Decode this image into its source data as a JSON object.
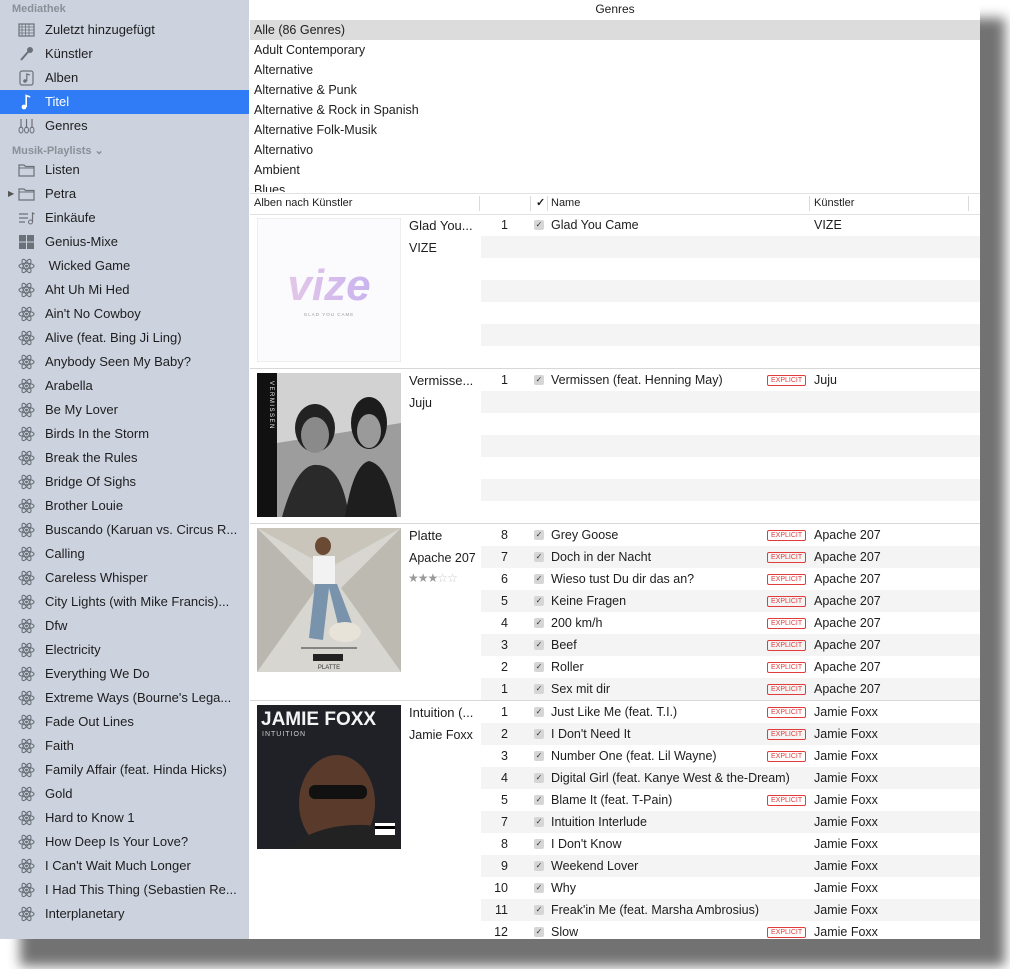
{
  "sidebar": {
    "library_header": "Mediathek",
    "library_items": [
      {
        "label": "Zuletzt hinzugefügt",
        "icon": "calendar-grid-icon"
      },
      {
        "label": "Künstler",
        "icon": "microphone-icon"
      },
      {
        "label": "Alben",
        "icon": "album-icon"
      },
      {
        "label": "Titel",
        "icon": "music-note-icon",
        "selected": true
      },
      {
        "label": "Genres",
        "icon": "guitars-icon"
      }
    ],
    "playlists_header": "Musik-Playlists ⌄",
    "playlist_items": [
      {
        "label": "Listen",
        "icon": "folder-icon"
      },
      {
        "label": "Petra",
        "icon": "folder-icon",
        "disclosure": "▶"
      },
      {
        "label": "Einkäufe",
        "icon": "purchased-list-icon"
      },
      {
        "label": "Genius-Mixe",
        "icon": "genius-grid-icon"
      },
      {
        "label": " Wicked Game",
        "icon": "genius-atom-icon"
      },
      {
        "label": "Aht Uh Mi Hed",
        "icon": "genius-atom-icon"
      },
      {
        "label": "Ain't No Cowboy",
        "icon": "genius-atom-icon"
      },
      {
        "label": "Alive (feat. Bing Ji Ling)",
        "icon": "genius-atom-icon"
      },
      {
        "label": "Anybody Seen My Baby?",
        "icon": "genius-atom-icon"
      },
      {
        "label": "Arabella",
        "icon": "genius-atom-icon"
      },
      {
        "label": "Be My Lover",
        "icon": "genius-atom-icon"
      },
      {
        "label": "Birds In the Storm",
        "icon": "genius-atom-icon"
      },
      {
        "label": "Break the Rules",
        "icon": "genius-atom-icon"
      },
      {
        "label": "Bridge Of Sighs",
        "icon": "genius-atom-icon"
      },
      {
        "label": "Brother Louie",
        "icon": "genius-atom-icon"
      },
      {
        "label": "Buscando (Karuan vs. Circus R...",
        "icon": "genius-atom-icon"
      },
      {
        "label": "Calling",
        "icon": "genius-atom-icon"
      },
      {
        "label": "Careless Whisper",
        "icon": "genius-atom-icon"
      },
      {
        "label": "City Lights (with Mike Francis)...",
        "icon": "genius-atom-icon"
      },
      {
        "label": "Dfw",
        "icon": "genius-atom-icon"
      },
      {
        "label": "Electricity",
        "icon": "genius-atom-icon"
      },
      {
        "label": "Everything We Do",
        "icon": "genius-atom-icon"
      },
      {
        "label": "Extreme Ways (Bourne's Lega...",
        "icon": "genius-atom-icon"
      },
      {
        "label": "Fade Out Lines",
        "icon": "genius-atom-icon"
      },
      {
        "label": "Faith",
        "icon": "genius-atom-icon"
      },
      {
        "label": "Family Affair (feat. Hinda Hicks)",
        "icon": "genius-atom-icon"
      },
      {
        "label": "Gold",
        "icon": "genius-atom-icon"
      },
      {
        "label": "Hard to Know 1",
        "icon": "genius-atom-icon"
      },
      {
        "label": "How Deep Is Your Love?",
        "icon": "genius-atom-icon"
      },
      {
        "label": "I Can't Wait Much Longer",
        "icon": "genius-atom-icon"
      },
      {
        "label": "I Had This Thing (Sebastien Re...",
        "icon": "genius-atom-icon"
      },
      {
        "label": "Interplanetary",
        "icon": "genius-atom-icon"
      }
    ]
  },
  "genres": {
    "title": "Genres",
    "items": [
      "Alle (86 Genres)",
      "Adult Contemporary",
      "Alternative",
      "Alternative & Punk",
      "Alternative & Rock in Spanish",
      "Alternative Folk-Musik",
      "Alternativo",
      "Ambient",
      "Blues"
    ]
  },
  "columns": {
    "albums_by_artist": "Alben nach Künstler",
    "check": "✓",
    "name": "Name",
    "artist": "Künstler"
  },
  "explicit_label": "EXPLICIT",
  "check_mark": "✓",
  "albums": [
    {
      "title": "Glad You...",
      "artist": "VIZE",
      "cover": "vize",
      "cover_text": "vize",
      "cover_subtext": "GLAD YOU CAME",
      "tracks": [
        {
          "num": "1",
          "name": "Glad You Came",
          "explicit": false,
          "artist": "VIZE"
        }
      ]
    },
    {
      "title": "Vermisse...",
      "artist": "Juju",
      "cover": "juju",
      "cover_text": "VERMISSEN",
      "tracks": [
        {
          "num": "1",
          "name": "Vermissen (feat. Henning May)",
          "explicit": true,
          "artist": "Juju"
        }
      ]
    },
    {
      "title": "Platte",
      "artist": "Apache 207",
      "rating": 3,
      "cover": "platte",
      "cover_text": "PLATTE",
      "tracks": [
        {
          "num": "8",
          "name": "Grey Goose",
          "explicit": true,
          "artist": "Apache 207"
        },
        {
          "num": "7",
          "name": "Doch in der Nacht",
          "explicit": true,
          "artist": "Apache 207"
        },
        {
          "num": "6",
          "name": "Wieso tust Du dir das an?",
          "explicit": true,
          "artist": "Apache 207"
        },
        {
          "num": "5",
          "name": "Keine Fragen",
          "explicit": true,
          "artist": "Apache 207"
        },
        {
          "num": "4",
          "name": "200 km/h",
          "explicit": true,
          "artist": "Apache 207"
        },
        {
          "num": "3",
          "name": "Beef",
          "explicit": true,
          "artist": "Apache 207"
        },
        {
          "num": "2",
          "name": "Roller",
          "explicit": true,
          "artist": "Apache 207"
        },
        {
          "num": "1",
          "name": "Sex mit dir",
          "explicit": true,
          "artist": "Apache 207"
        }
      ]
    },
    {
      "title": "Intuition (...",
      "artist": "Jamie Foxx",
      "cover": "foxx",
      "cover_text": "JAMIE FOXX",
      "cover_subtext": "INTUITION",
      "tracks": [
        {
          "num": "1",
          "name": "Just Like Me (feat. T.I.)",
          "explicit": true,
          "artist": "Jamie Foxx"
        },
        {
          "num": "2",
          "name": "I Don't Need It",
          "explicit": true,
          "artist": "Jamie Foxx"
        },
        {
          "num": "3",
          "name": "Number One (feat. Lil Wayne)",
          "explicit": true,
          "artist": "Jamie Foxx"
        },
        {
          "num": "4",
          "name": "Digital Girl (feat. Kanye West & the-Dream)",
          "explicit": false,
          "artist": "Jamie Foxx"
        },
        {
          "num": "5",
          "name": "Blame It (feat. T-Pain)",
          "explicit": true,
          "artist": "Jamie Foxx"
        },
        {
          "num": "7",
          "name": "Intuition Interlude",
          "explicit": false,
          "artist": "Jamie Foxx"
        },
        {
          "num": "8",
          "name": "I Don't Know",
          "explicit": false,
          "artist": "Jamie Foxx"
        },
        {
          "num": "9",
          "name": "Weekend Lover",
          "explicit": false,
          "artist": "Jamie Foxx"
        },
        {
          "num": "10",
          "name": "Why",
          "explicit": false,
          "artist": "Jamie Foxx"
        },
        {
          "num": "11",
          "name": "Freak'in Me (feat. Marsha Ambrosius)",
          "explicit": false,
          "artist": "Jamie Foxx"
        },
        {
          "num": "12",
          "name": "Slow",
          "explicit": true,
          "artist": "Jamie Foxx"
        }
      ]
    }
  ],
  "colors": {
    "selection": "#2f7cf6",
    "sidebar": "#cdd3de",
    "explicit": "#e23b3b"
  }
}
